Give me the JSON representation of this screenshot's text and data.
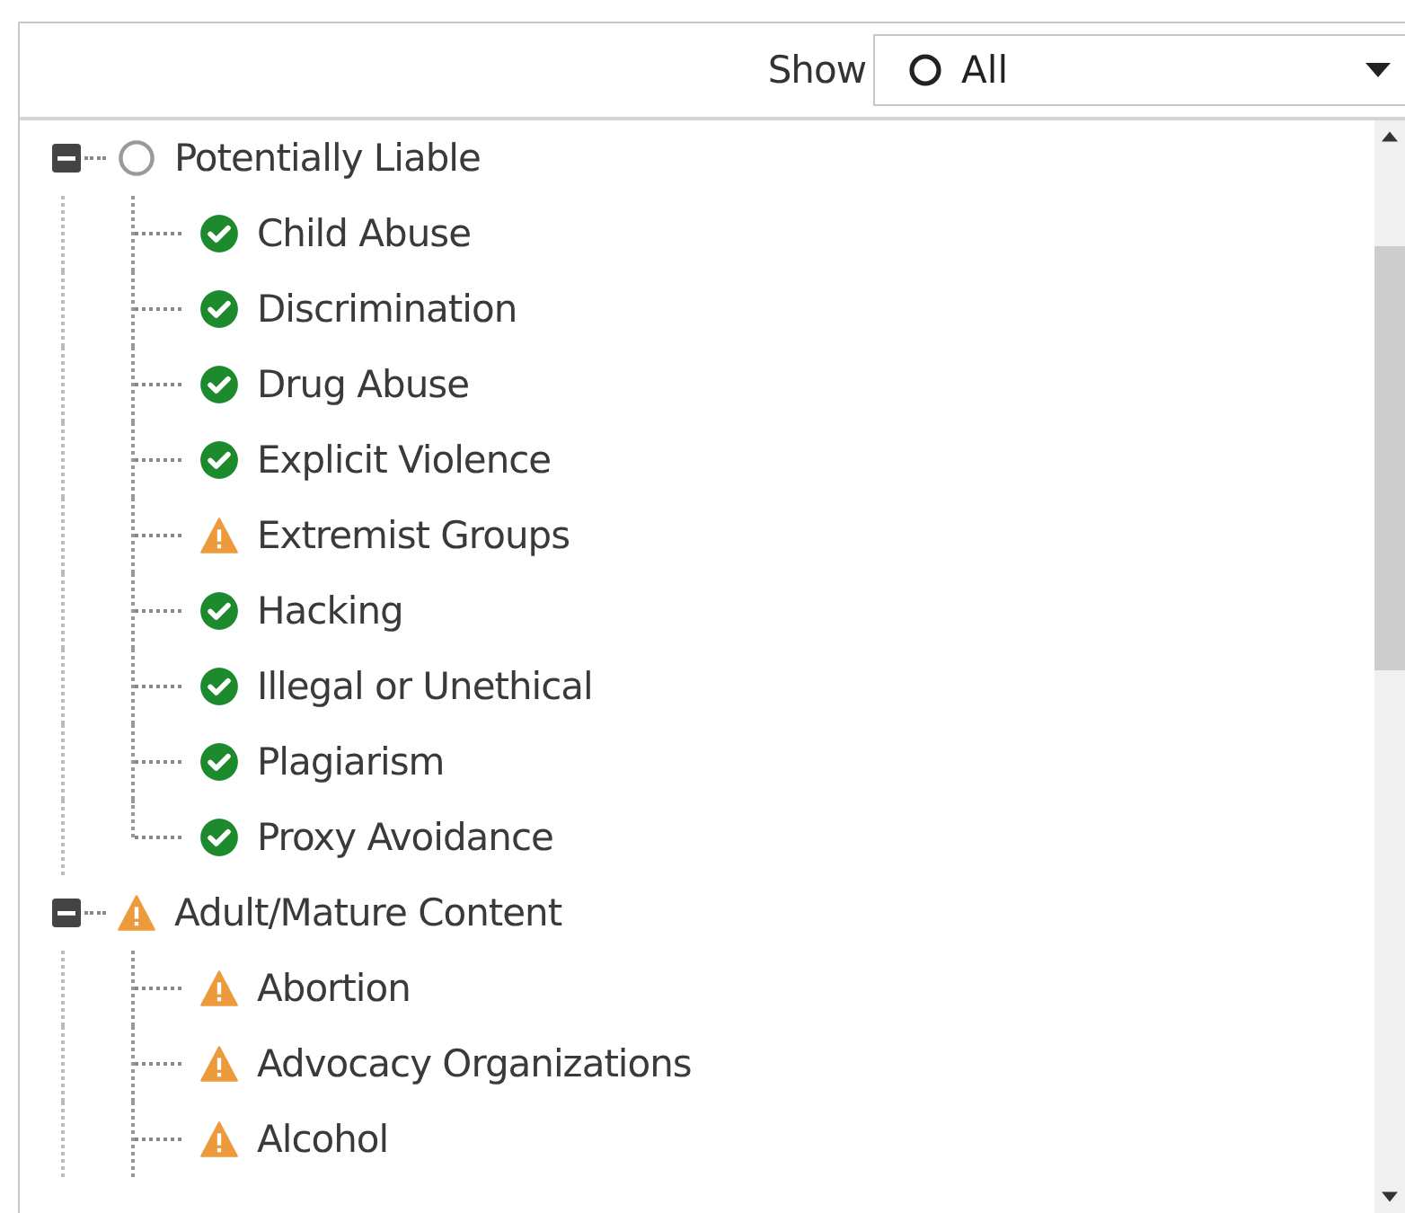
{
  "filter": {
    "label": "Show",
    "value": "All"
  },
  "tree": [
    {
      "label": "Potentially Liable",
      "kind": "none",
      "expanded": true,
      "children": [
        {
          "label": "Child Abuse",
          "kind": "ok"
        },
        {
          "label": "Discrimination",
          "kind": "ok"
        },
        {
          "label": "Drug Abuse",
          "kind": "ok"
        },
        {
          "label": "Explicit Violence",
          "kind": "ok"
        },
        {
          "label": "Extremist Groups",
          "kind": "warn"
        },
        {
          "label": "Hacking",
          "kind": "ok"
        },
        {
          "label": "Illegal or Unethical",
          "kind": "ok"
        },
        {
          "label": "Plagiarism",
          "kind": "ok"
        },
        {
          "label": "Proxy Avoidance",
          "kind": "ok"
        }
      ]
    },
    {
      "label": "Adult/Mature Content",
      "kind": "warn",
      "expanded": true,
      "children": [
        {
          "label": "Abortion",
          "kind": "warn"
        },
        {
          "label": "Advocacy Organizations",
          "kind": "warn"
        },
        {
          "label": "Alcohol",
          "kind": "warn"
        }
      ]
    }
  ]
}
